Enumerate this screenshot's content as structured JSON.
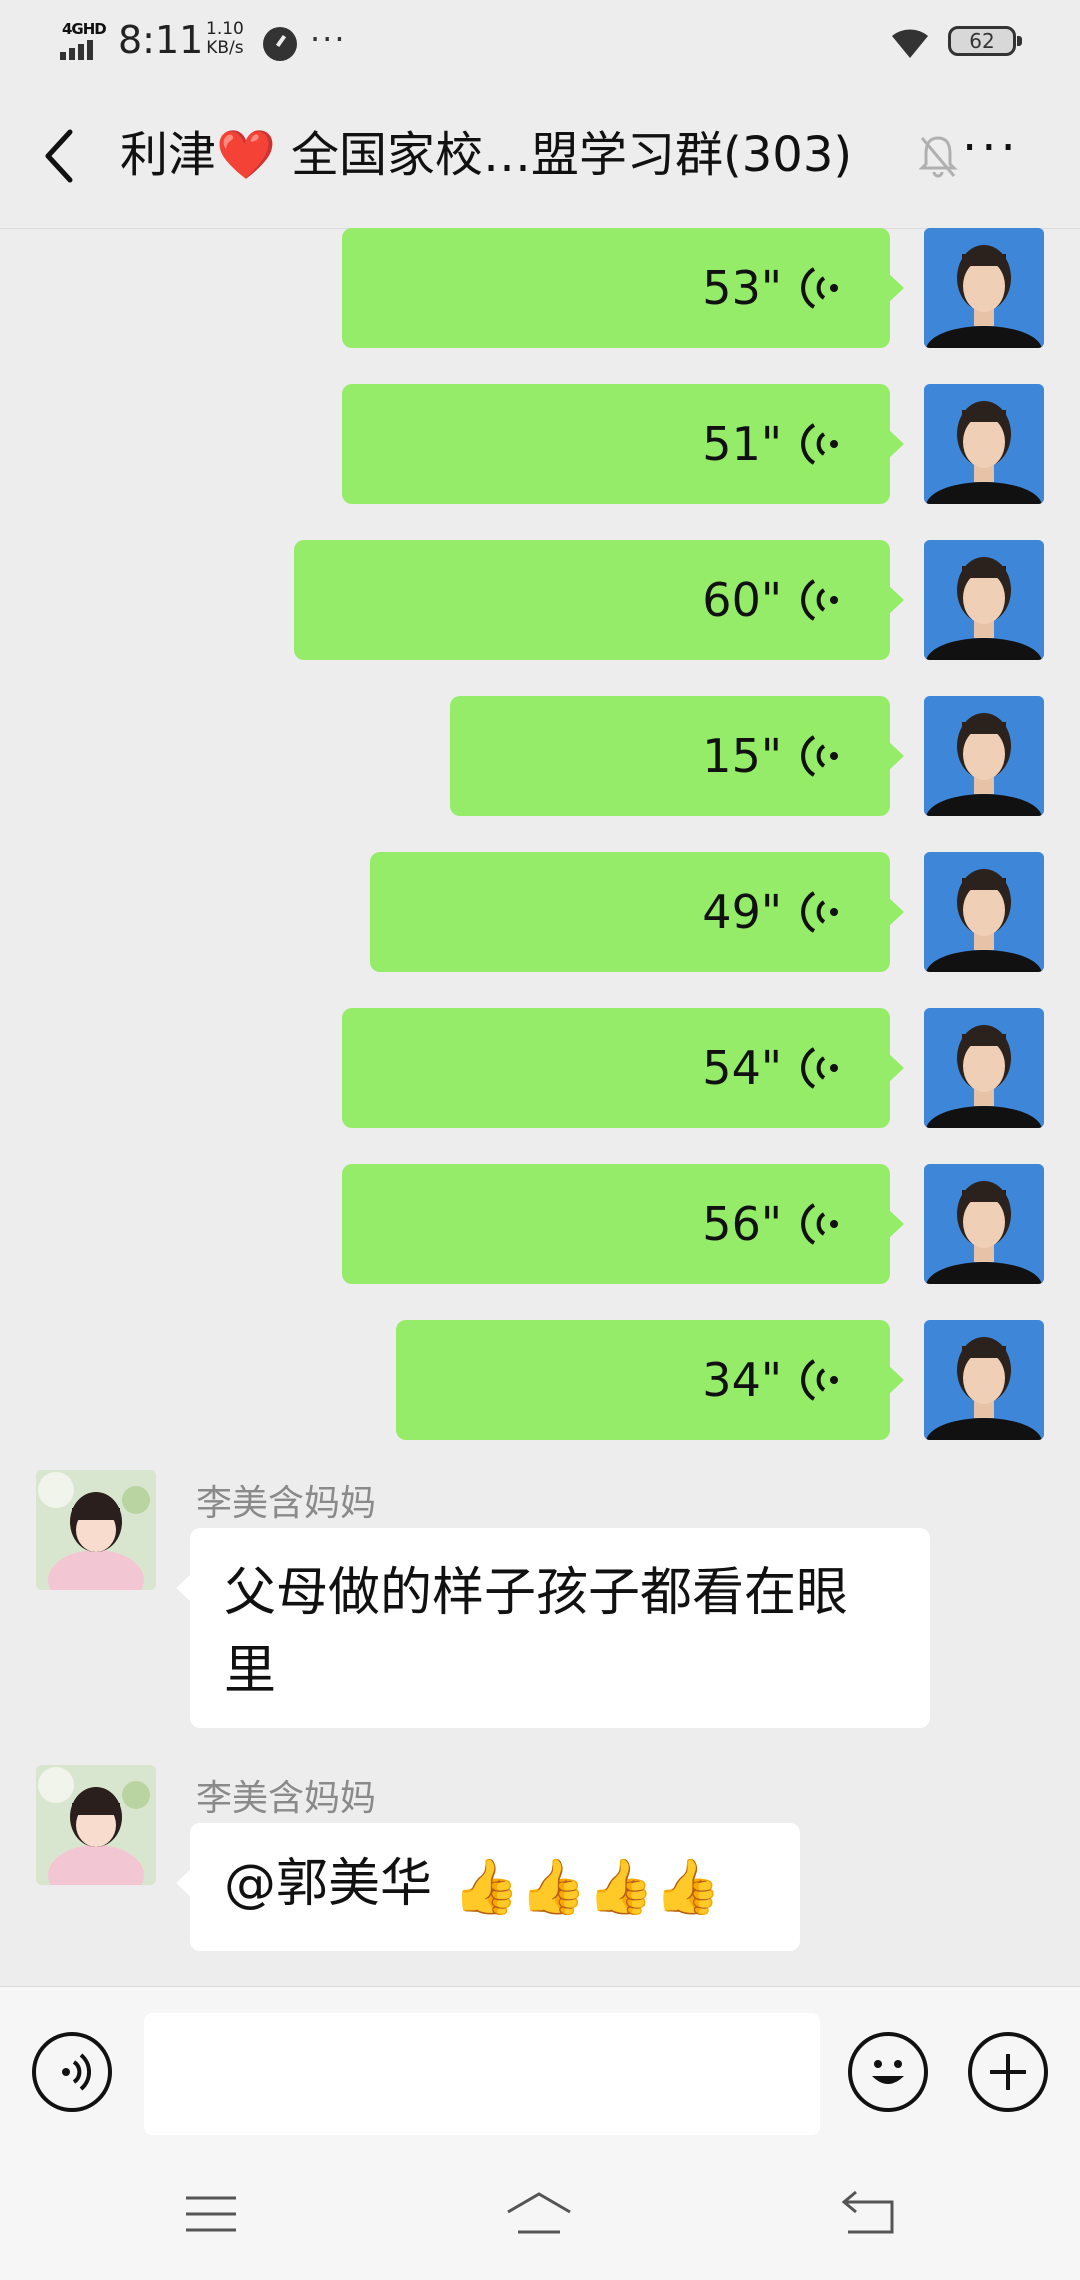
{
  "status_bar": {
    "network": "4GHD",
    "time": "8:11",
    "speed_value": "1.10",
    "speed_unit": "KB/s",
    "more": "···",
    "battery": "62"
  },
  "header": {
    "title_prefix": "利津",
    "title_icon": "❤️",
    "title_suffix": " 全国家校…盟学习群(303)",
    "more": "···"
  },
  "voice_messages": [
    {
      "duration": "53\""
    },
    {
      "duration": "51\""
    },
    {
      "duration": "60\""
    },
    {
      "duration": "15\""
    },
    {
      "duration": "49\""
    },
    {
      "duration": "54\""
    },
    {
      "duration": "56\""
    },
    {
      "duration": "34\""
    }
  ],
  "text_messages": [
    {
      "sender": "李美含妈妈",
      "text": "父母做的样子孩子都看在眼里"
    },
    {
      "sender": "李美含妈妈",
      "text": "@郭美华 ",
      "emojis": "👍👍👍👍"
    }
  ],
  "icons": {
    "back": "chevron-left-icon",
    "mute": "bell-off-icon",
    "voice": "voice-wave-icon",
    "emoji": "smiley-icon",
    "plus": "plus-icon",
    "nav_menu": "menu-icon",
    "nav_home": "home-icon",
    "nav_back": "back-arrow-icon"
  },
  "colors": {
    "background": "#ededed",
    "self_bubble": "#95ec69",
    "other_bubble": "#ffffff",
    "self_avatar_bg": "#3e87d8",
    "heart": "#e0302b"
  }
}
